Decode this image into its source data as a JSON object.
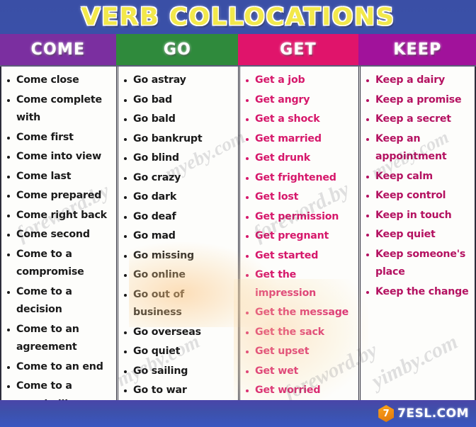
{
  "poster": {
    "title": "VERB COLLOCATIONS",
    "background_color": "#3b4fa8",
    "title_color": "#f2e84b"
  },
  "columns": [
    {
      "header": "COME",
      "header_color": "#7b2fa0",
      "text_color": "#1a1a1a",
      "items": [
        "Come close",
        "Come complete with",
        "Come first",
        "Come into view",
        "Come last",
        "Come prepared",
        "Come right back",
        "Come second",
        "Come to a compromise",
        "Come to a decision",
        "Come to an agreement",
        "Come to an end",
        "Come to a standstill"
      ]
    },
    {
      "header": "GO",
      "header_color": "#2f8a3c",
      "text_color": "#1a1a1a",
      "items": [
        "Go astray",
        "Go bad",
        "Go bald",
        "Go bankrupt",
        "Go blind",
        "Go crazy",
        "Go dark",
        "Go deaf",
        "Go mad",
        "Go missing",
        "Go online",
        "Go out of business",
        "Go overseas",
        "Go quiet",
        "Go sailing",
        "Go to war"
      ]
    },
    {
      "header": "GET",
      "header_color": "#e0146b",
      "text_color": "#d6186b",
      "items": [
        "Get a job",
        "Get angry",
        "Get a shock",
        "Get married",
        "Get drunk",
        "Get frightened",
        "Get lost",
        "Get permission",
        "Get pregnant",
        "Get started",
        "Get the impression",
        "Get the message",
        "Get the sack",
        "Get upset",
        "Get wet",
        "Get worried"
      ]
    },
    {
      "header": "KEEP",
      "header_color": "#a1129b",
      "text_color": "#b41261",
      "items": [
        "Keep a dairy",
        "Keep a promise",
        "Keep a secret",
        "Keep an appointment",
        "Keep calm",
        "Keep control",
        "Keep in touch",
        "Keep quiet",
        "Keep someone's place",
        "Keep the change"
      ]
    }
  ],
  "watermarks": [
    "foreword.by",
    "myeby.com",
    "foreword.by",
    "myeby.com",
    "foreword.by",
    "myeby.com",
    "yimby.com"
  ],
  "footer": {
    "brand_mark": "7",
    "brand_text": "7ESL.COM"
  }
}
